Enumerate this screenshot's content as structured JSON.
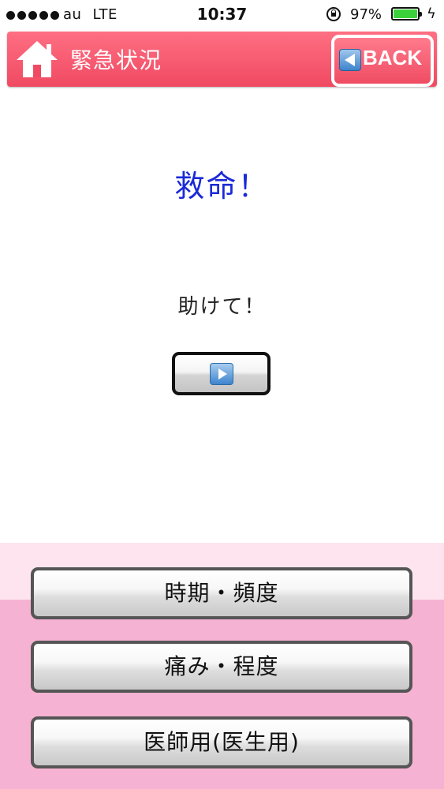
{
  "status_bar": {
    "carrier": "au",
    "network": "LTE",
    "time": "10:37",
    "battery_percent": "97%"
  },
  "header": {
    "title": "緊急状況",
    "back_label": "BACK",
    "color": "#f04a62"
  },
  "phrase": {
    "title": "救命！",
    "text": "助けて！",
    "title_color": "#1a2ad8"
  },
  "menu": [
    {
      "label": "時期・頻度"
    },
    {
      "label": "痛み・程度"
    },
    {
      "label": "医師用(医生用)"
    }
  ],
  "icons": [
    "home-icon",
    "back-arrow-icon",
    "play-icon",
    "lock-icon",
    "battery-icon",
    "charging-icon"
  ]
}
